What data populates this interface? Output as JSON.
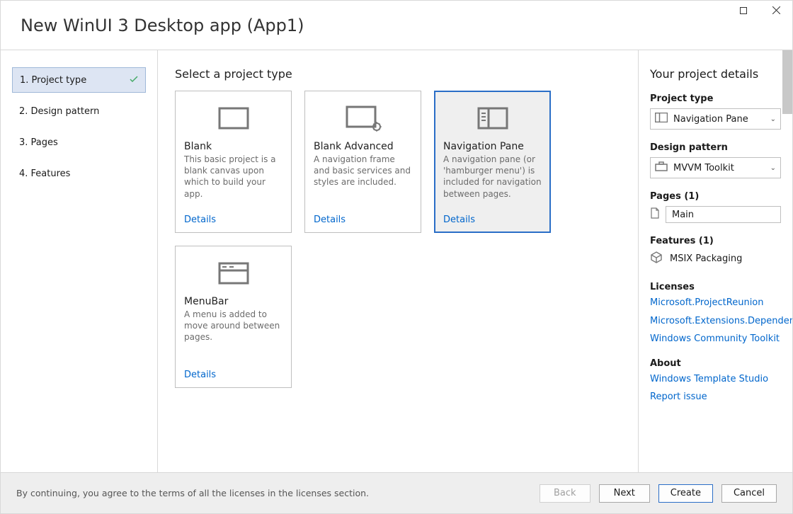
{
  "titlebar": {
    "title": "New WinUI 3 Desktop app (App1)"
  },
  "sidebar": {
    "steps": [
      {
        "label": "1. Project type",
        "selected": true,
        "completed": true
      },
      {
        "label": "2. Design pattern",
        "selected": false,
        "completed": false
      },
      {
        "label": "3. Pages",
        "selected": false,
        "completed": false
      },
      {
        "label": "4. Features",
        "selected": false,
        "completed": false
      }
    ]
  },
  "main": {
    "heading": "Select a project type",
    "cards": [
      {
        "id": "blank",
        "title": "Blank",
        "desc": "This basic project is a blank canvas upon which to build your app.",
        "details": "Details",
        "selected": false
      },
      {
        "id": "blank-advanced",
        "title": "Blank Advanced",
        "desc": "A navigation frame and basic services and styles are included.",
        "details": "Details",
        "selected": false
      },
      {
        "id": "navigation-pane",
        "title": "Navigation Pane",
        "desc": "A navigation pane (or 'hamburger menu') is included for navigation between pages.",
        "details": "Details",
        "selected": true
      },
      {
        "id": "menubar",
        "title": "MenuBar",
        "desc": "A menu is added to move around between pages.",
        "details": "Details",
        "selected": false
      }
    ]
  },
  "right": {
    "heading": "Your project details",
    "project_type": {
      "label": "Project type",
      "value": "Navigation Pane"
    },
    "design_pattern": {
      "label": "Design pattern",
      "value": "MVVM Toolkit"
    },
    "pages": {
      "label": "Pages (1)",
      "items": [
        "Main"
      ]
    },
    "features": {
      "label": "Features (1)",
      "items": [
        "MSIX Packaging"
      ]
    },
    "licenses": {
      "label": "Licenses",
      "items": [
        "Microsoft.ProjectReunion",
        "Microsoft.Extensions.DependencyInjection",
        "Windows Community Toolkit"
      ]
    },
    "about": {
      "label": "About",
      "items": [
        "Windows Template Studio",
        "Report issue"
      ]
    }
  },
  "footer": {
    "text": "By continuing, you agree to the terms of all the licenses in the licenses section.",
    "back": "Back",
    "next": "Next",
    "create": "Create",
    "cancel": "Cancel"
  }
}
